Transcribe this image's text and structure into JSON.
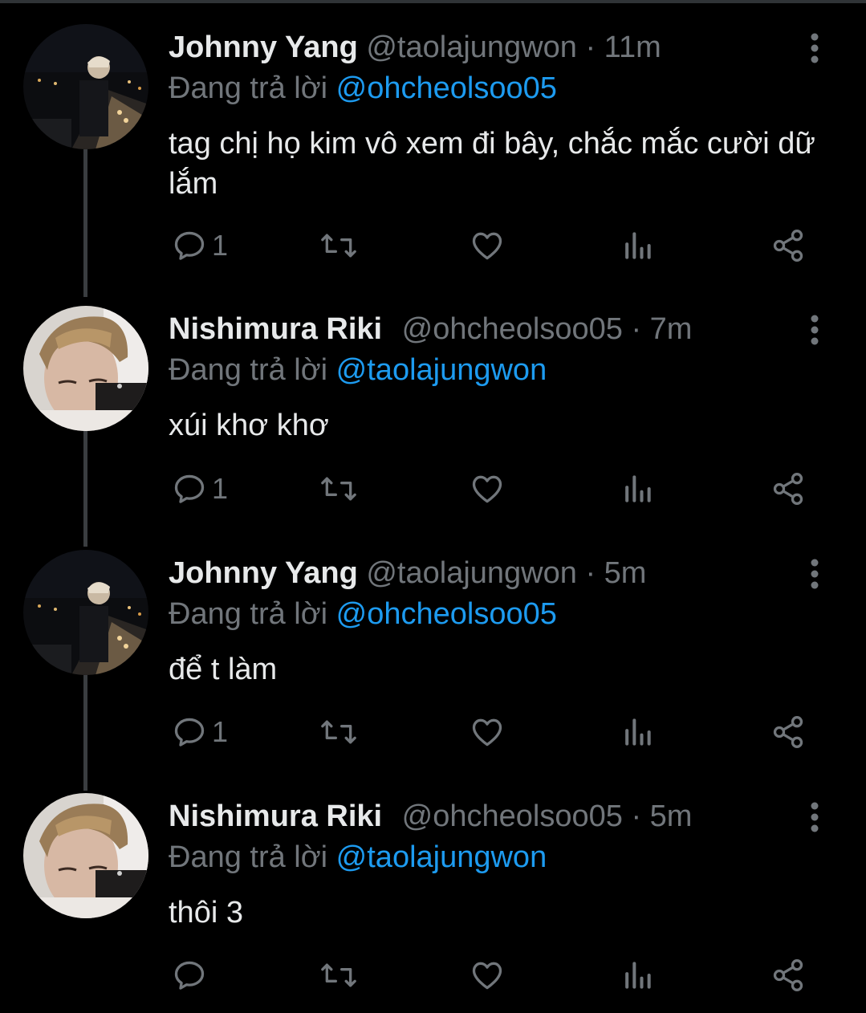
{
  "colors": {
    "background": "#000000",
    "name": "#e7e9ea",
    "secondary": "#71767b",
    "mention": "#1d9bf0",
    "thread_line": "#3a3d40"
  },
  "tweets": [
    {
      "name": "Johnny Yang",
      "handle": "@taolajungwon",
      "separator": "·",
      "time": "11m",
      "reply_prefix": "Đang trả lời",
      "reply_to": "@ohcheolsoo05",
      "text": "tag chị họ kim vô xem đi bây, chắc mắc cười dữ lắm",
      "reply_count": "1",
      "avatar": "night-city-avatar"
    },
    {
      "name": "Nishimura Riki",
      "handle": "@ohcheolsoo05",
      "separator": "·",
      "time": "7m",
      "reply_prefix": "Đang trả lời",
      "reply_to": "@taolajungwon",
      "text": "xúi khơ khơ",
      "reply_count": "1",
      "avatar": "portrait-avatar"
    },
    {
      "name": "Johnny Yang",
      "handle": "@taolajungwon",
      "separator": "·",
      "time": "5m",
      "reply_prefix": "Đang trả lời",
      "reply_to": "@ohcheolsoo05",
      "text": "để t làm",
      "reply_count": "1",
      "avatar": "night-city-avatar"
    },
    {
      "name": "Nishimura Riki",
      "handle": "@ohcheolsoo05",
      "separator": "·",
      "time": "5m",
      "reply_prefix": "Đang trả lời",
      "reply_to": "@taolajungwon",
      "text": "thôi 3",
      "reply_count": "",
      "avatar": "portrait-avatar"
    }
  ]
}
